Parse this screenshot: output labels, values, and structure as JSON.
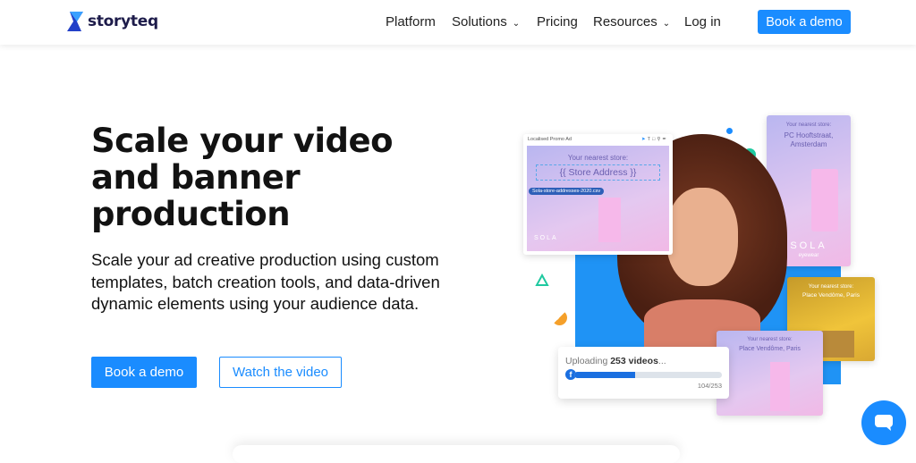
{
  "nav": {
    "brand": "storyteq",
    "items": [
      {
        "label": "Platform"
      },
      {
        "label": "Solutions",
        "dropdown": true
      },
      {
        "label": "Pricing"
      },
      {
        "label": "Resources",
        "dropdown": true
      },
      {
        "label": "Log in"
      }
    ],
    "cta": "Book a demo"
  },
  "hero": {
    "title": "Scale your video and banner production",
    "description": "Scale your ad creative production using custom templates, batch creation tools, and data-driven dynamic elements using your audience data.",
    "primary_button": "Book a demo",
    "secondary_button": "Watch the video"
  },
  "visual": {
    "editor": {
      "title": "Localised Promo Ad",
      "label": "Your nearest store:",
      "field": "{{ Store Address }}",
      "file": "Sola-store-addresses-2020.csv",
      "brand": "SOLA"
    },
    "card_amsterdam": {
      "label": "Your nearest store:",
      "address": "PC Hooftstraat, Amsterdam",
      "brand": "SOLA",
      "sub": "eyewear"
    },
    "card_yellow": {
      "label": "Your nearest store:",
      "address": "Place Vendôme, Paris"
    },
    "card_paris": {
      "label": "Your nearest store:",
      "address": "Place Vendôme, Paris"
    },
    "upload": {
      "prefix": "Uploading ",
      "count": "253 videos",
      "suffix": "...",
      "progress_text": "104/253",
      "progress": 0.41
    }
  },
  "colors": {
    "accent": "#1a8cff",
    "brand_dark": "#1d1b4a"
  }
}
